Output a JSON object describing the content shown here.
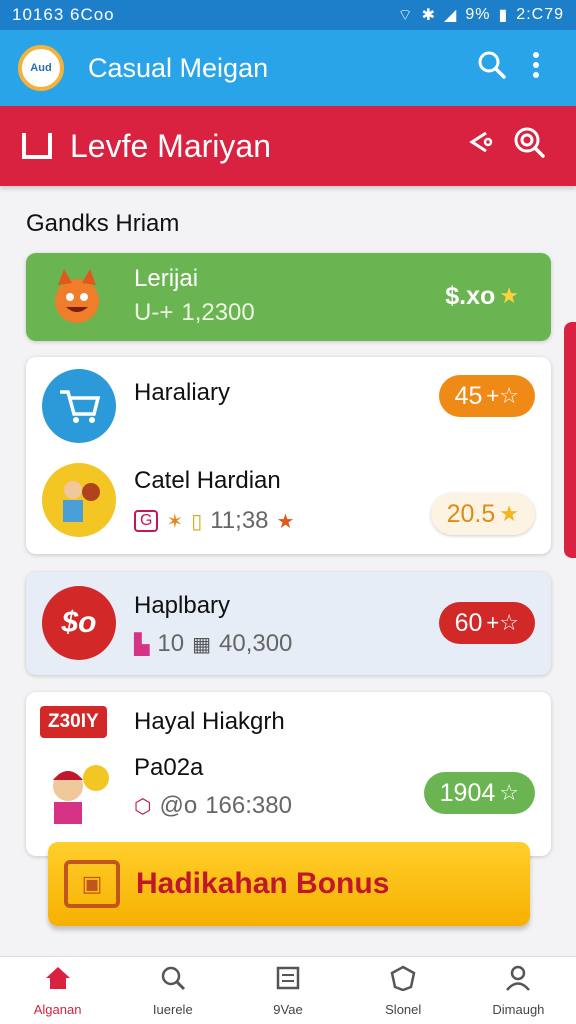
{
  "status_bar": {
    "time_left": "10163 6Coo",
    "battery_text": "9%",
    "time_right": "2:C79"
  },
  "app_bar": {
    "logo_text": "Aud",
    "title": "Casual Meigan"
  },
  "banner": {
    "title": "Levfe Mariyan"
  },
  "section": {
    "title": "Gandks Hriam"
  },
  "featured": {
    "name": "Lerijai",
    "meta_prefix": "U-+",
    "meta_value": "1,2300",
    "price": "$.xo",
    "bg": "#6ab552"
  },
  "card1": {
    "items": [
      {
        "name": "Haraliary",
        "pill": "45",
        "pill_color": "#f08a17"
      },
      {
        "name": "Catel Hardian",
        "meta_a": "G",
        "meta_b": "11;38",
        "pill": "20.5",
        "pill_color": "#fdf3e2"
      }
    ]
  },
  "card2": {
    "name": "Haplbary",
    "meta_a": "10",
    "meta_b": "40,300",
    "pill": "60",
    "pill_color": "#d22828",
    "bg": "#e6edf7",
    "avatar_text": "$o"
  },
  "card3": {
    "badge": "Z30IY",
    "name": "Hayal Hiakgrh",
    "subname": "Pa02a",
    "meta_a": "@o",
    "meta_b": "166:380",
    "pill": "1904",
    "pill_color": "#6ab552"
  },
  "bonus": {
    "label": "Hadikahan Bonus"
  },
  "tabs": [
    {
      "label": "Alganan",
      "icon": "home-icon"
    },
    {
      "label": "Iuerele",
      "icon": "search-icon"
    },
    {
      "label": "9Vae",
      "icon": "list-icon"
    },
    {
      "label": "Slonel",
      "icon": "shield-icon"
    },
    {
      "label": "Dimaugh",
      "icon": "profile-icon"
    }
  ],
  "colors": {
    "primary": "#2aa4e8",
    "accent": "#d8223f",
    "bonus": "#ffcf2b"
  }
}
